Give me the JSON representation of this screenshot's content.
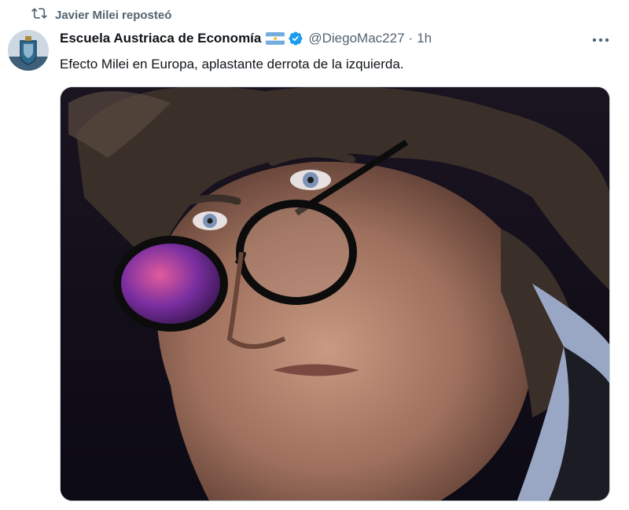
{
  "repost": {
    "icon": "repost-icon",
    "text": "Javier Milei reposteó"
  },
  "tweet": {
    "author_name": "Escuela Austriaca de Economía",
    "flag_icon": "argentina-flag-icon",
    "verified_icon": "verified-badge-icon",
    "verified_color": "#1d9bf0",
    "handle": "@DiegoMac227",
    "separator": "·",
    "time": "1h",
    "text": "Efecto Milei en Europa, aplastante derrota de la izquierda.",
    "more_icon": "more-options-icon"
  },
  "colors": {
    "secondary_text": "#536471",
    "primary_text": "#0f1419"
  }
}
